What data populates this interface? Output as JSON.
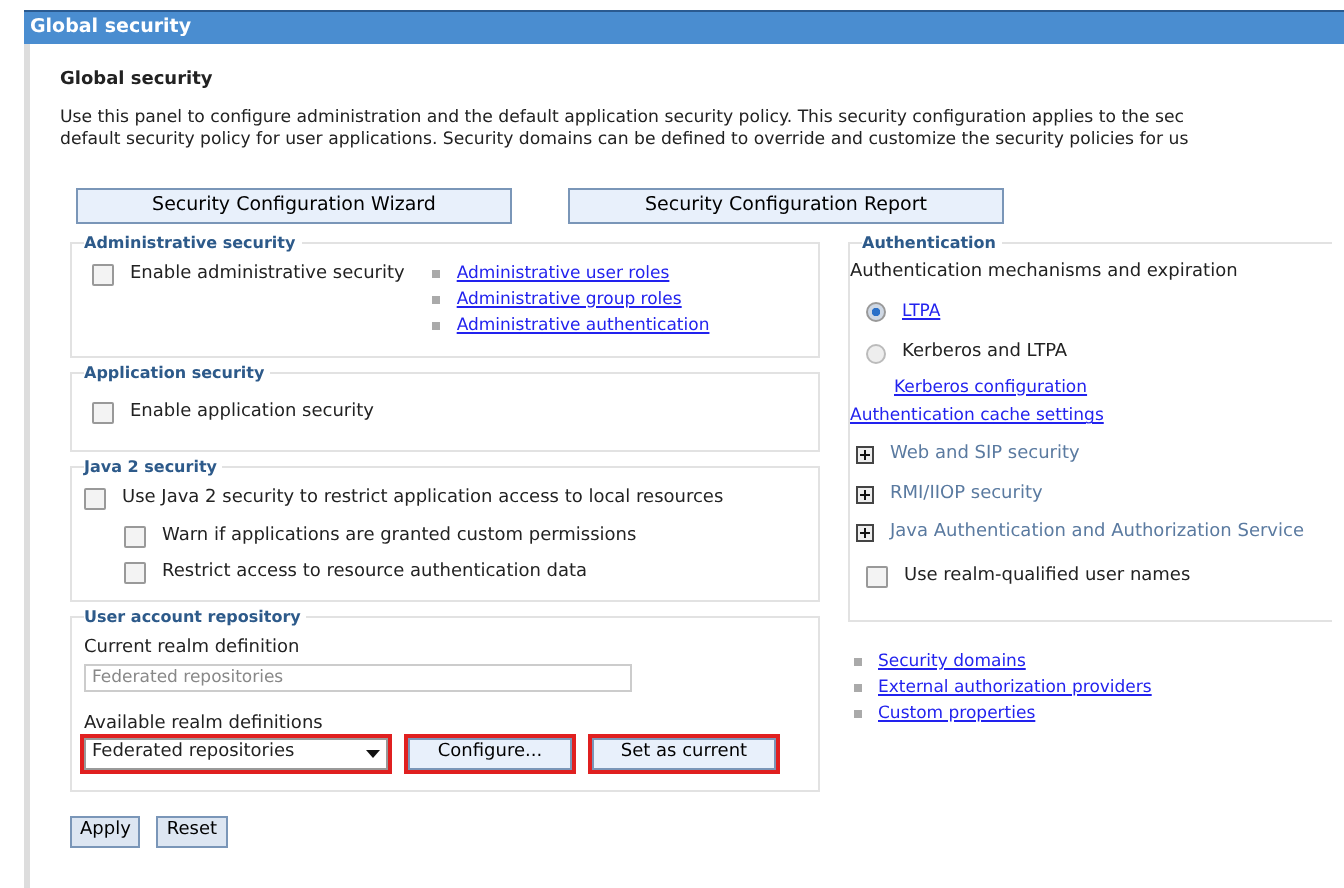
{
  "window": {
    "title": "Global security"
  },
  "heading": "Global security",
  "description": [
    "Use this panel to configure administration and the default application security policy. This security configuration applies to the sec",
    "default security policy for user applications. Security domains can be defined to override and customize the security policies for us"
  ],
  "top_buttons": [
    "Security Configuration Wizard",
    "Security Configuration Report"
  ],
  "administrative_security": {
    "legend": "Administrative security",
    "checkbox": {
      "label": "Enable administrative security",
      "checked": false
    },
    "links": [
      "Administrative user roles",
      "Administrative group roles",
      "Administrative authentication"
    ]
  },
  "application_security": {
    "legend": "Application security",
    "checkbox": {
      "label": "Enable application security",
      "checked": false
    }
  },
  "java2_security": {
    "legend": "Java 2 security",
    "checkbox": {
      "label": "Use Java 2 security to restrict application access to local resources",
      "checked": false,
      "children": [
        {
          "label": "Warn if applications are granted custom permissions",
          "checked": false
        },
        {
          "label": "Restrict access to resource authentication data",
          "checked": false
        }
      ]
    }
  },
  "user_account_repository": {
    "legend": "User account repository",
    "current_label": "Current realm definition",
    "current_value": "Federated repositories",
    "available_label": "Available realm definitions",
    "select": {
      "value": "Federated repositories",
      "highlighted": true
    },
    "buttons": [
      {
        "label": "Configure...",
        "highlighted": true
      },
      {
        "label": "Set as current",
        "highlighted": true
      }
    ]
  },
  "authentication": {
    "legend": "Authentication",
    "subtitle": "Authentication mechanisms and expiration",
    "options": [
      {
        "label": "LTPA",
        "kind": "link",
        "selected": true
      },
      {
        "label": "Kerberos and LTPA",
        "kind": "text",
        "selected": false
      }
    ],
    "kerberos_link": "Kerberos configuration",
    "cache_link": "Authentication cache settings",
    "sections": [
      {
        "label": "Web and SIP security",
        "expanded": false
      },
      {
        "label": "RMI/IIOP security",
        "expanded": false
      },
      {
        "label": "Java Authentication and Authorization Service",
        "expanded": false
      }
    ],
    "checkbox": {
      "label": "Use realm-qualified user names",
      "checked": false
    }
  },
  "links": [
    "Security domains",
    "External authorization providers",
    "Custom properties"
  ],
  "buttons": [
    "Apply",
    "Reset"
  ]
}
